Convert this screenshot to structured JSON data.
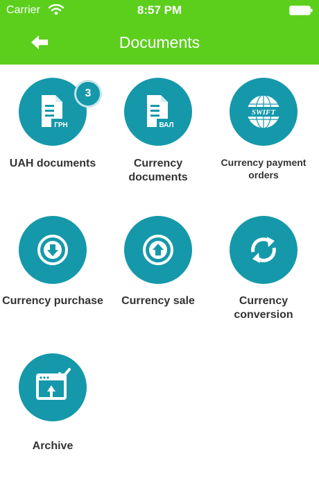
{
  "status_bar": {
    "carrier": "Carrier",
    "time": "8:57 PM"
  },
  "header": {
    "title": "Documents",
    "back_icon": "arrow-left-icon"
  },
  "tiles": [
    {
      "label": "UAH documents",
      "icon": "document-uah-icon",
      "icon_text": "ГРН",
      "badge": "3"
    },
    {
      "label": "Currency documents",
      "icon": "document-currency-icon",
      "icon_text": "ВАЛ"
    },
    {
      "label": "Currency payment orders",
      "icon": "swift-globe-icon",
      "icon_text": "SWIFT"
    },
    {
      "label": "Currency purchase",
      "icon": "arrow-down-circle-icon"
    },
    {
      "label": "Currency sale",
      "icon": "arrow-up-circle-icon"
    },
    {
      "label": "Currency conversion",
      "icon": "refresh-arrows-icon"
    },
    {
      "label": "Archive",
      "icon": "archive-upload-icon"
    }
  ],
  "colors": {
    "header_bg": "#5ccf1d",
    "accent": "#1598aa",
    "text": "#333333"
  }
}
